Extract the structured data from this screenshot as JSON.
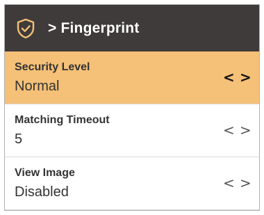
{
  "header": {
    "title": "> Fingerprint",
    "icon": "shield-check-icon"
  },
  "colors": {
    "header_bg": "#3f3b3a",
    "selected_row_bg": "#f5c077",
    "icon_color": "#f5c077"
  },
  "settings": [
    {
      "label": "Security Level",
      "value": "Normal",
      "prev": "<",
      "next": ">",
      "selected": true
    },
    {
      "label": "Matching Timeout",
      "value": "5",
      "prev": "<",
      "next": ">",
      "selected": false
    },
    {
      "label": "View Image",
      "value": "Disabled",
      "prev": "<",
      "next": ">",
      "selected": false
    }
  ]
}
